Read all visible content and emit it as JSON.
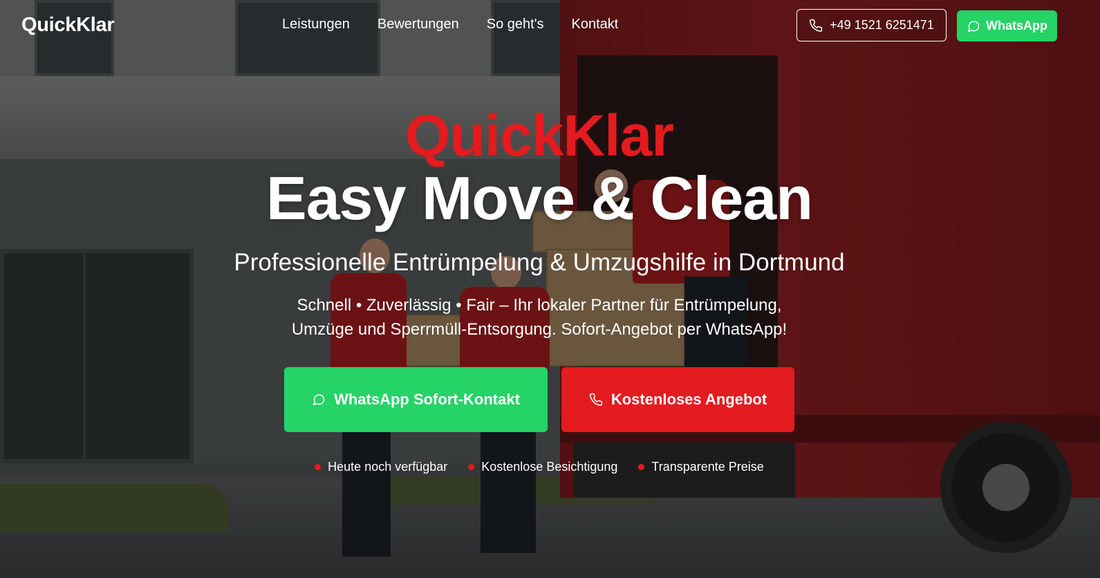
{
  "header": {
    "logo": "QuickKlar",
    "nav": [
      "Leistungen",
      "Bewertungen",
      "So geht's",
      "Kontakt"
    ],
    "phone": "+49 1521 6251471",
    "whatsapp": "WhatsApp"
  },
  "hero": {
    "brand": "QuickKlar",
    "title": "Easy Move & Clean",
    "subtitle": "Professionelle Entrümpelung & Umzugshilfe in Dortmund",
    "description_line1": "Schnell • Zuverlässig • Fair – Ihr lokaler Partner für Entrümpelung,",
    "description_line2": "Umzüge und Sperrmüll-Entsorgung. Sofort-Angebot per WhatsApp!",
    "cta_whatsapp": "WhatsApp Sofort-Kontakt",
    "cta_offer": "Kostenloses Angebot",
    "features": [
      "Heute noch verfügbar",
      "Kostenlose Besichtigung",
      "Transparente Preise"
    ]
  },
  "colors": {
    "brand_red": "#e41b1f",
    "whatsapp_green": "#25d366",
    "text": "#ffffff"
  },
  "icons": {
    "phone": "phone-icon",
    "whatsapp": "whatsapp-icon",
    "bullet": "red-dot"
  }
}
